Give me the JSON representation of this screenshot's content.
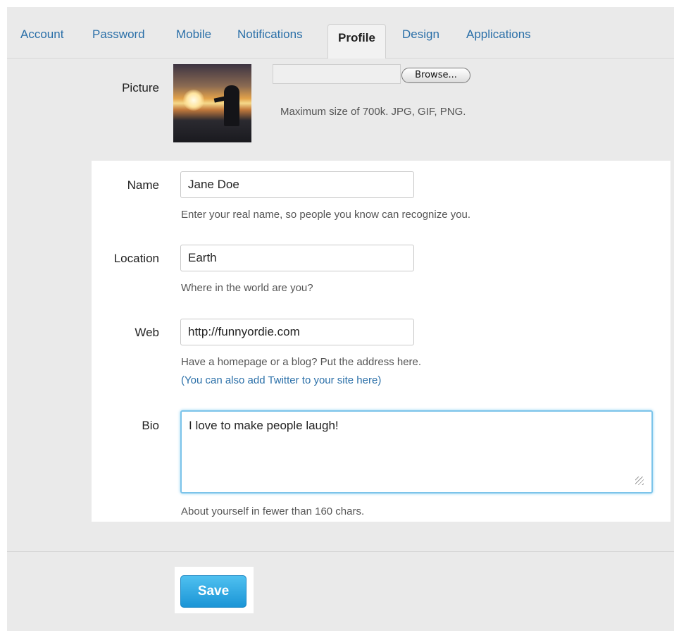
{
  "tabs": [
    {
      "label": "Account"
    },
    {
      "label": "Password"
    },
    {
      "label": "Mobile"
    },
    {
      "label": "Notifications"
    },
    {
      "label": "Profile",
      "active": true
    },
    {
      "label": "Design"
    },
    {
      "label": "Applications"
    }
  ],
  "picture": {
    "label": "Picture",
    "browse_label": "Browse...",
    "help": "Maximum size of 700k. JPG, GIF, PNG."
  },
  "name": {
    "label": "Name",
    "value": "Jane Doe",
    "help": "Enter your real name, so people you know can recognize you."
  },
  "location": {
    "label": "Location",
    "value": "Earth",
    "help": "Where in the world are you?"
  },
  "web": {
    "label": "Web",
    "value": "http://funnyordie.com",
    "help": "Have a homepage or a blog? Put the address here.",
    "link": "(You can also add Twitter to your site here)"
  },
  "bio": {
    "label": "Bio",
    "value": "I love to make people laugh!",
    "help": "About yourself in fewer than 160 chars."
  },
  "save_label": "Save",
  "colors": {
    "link": "#2a6fa8",
    "save_button": "#1b95d6",
    "focus_ring": "#7cc4ea"
  }
}
